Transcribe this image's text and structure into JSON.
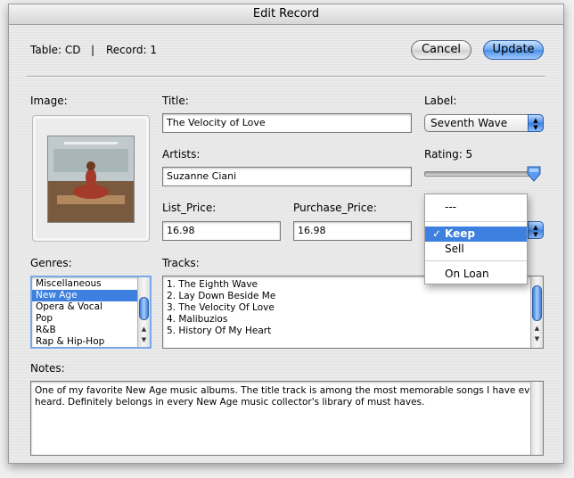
{
  "window": {
    "title": "Edit Record"
  },
  "header": {
    "table_text": "Table: CD",
    "separator": "|",
    "record_text": "Record: 1"
  },
  "buttons": {
    "cancel": "Cancel",
    "update": "Update"
  },
  "image": {
    "label": "Image:",
    "album_art_description": "album cover"
  },
  "title": {
    "label": "Title:",
    "value": "The Velocity of Love"
  },
  "artists": {
    "label": "Artists:",
    "value": "Suzanne Ciani"
  },
  "list_price": {
    "label": "List_Price:",
    "value": "16.98"
  },
  "purchase_price": {
    "label": "Purchase_Price:",
    "value": "16.98"
  },
  "label_field": {
    "label": "Label:",
    "value": "Seventh Wave"
  },
  "rating": {
    "label": "Rating: 5",
    "value": 5,
    "max": 5
  },
  "status_menu": {
    "items": [
      {
        "label": "---",
        "checked": false
      },
      {
        "label": "Keep",
        "checked": true,
        "check_mark": "✓"
      },
      {
        "label": "Sell",
        "checked": false
      },
      {
        "label": "On Loan",
        "checked": false
      }
    ]
  },
  "genres": {
    "label": "Genres:",
    "items": [
      "Miscellaneous",
      "New Age",
      "Opera & Vocal",
      "Pop",
      "R&B",
      "Rap & Hip-Hop"
    ],
    "selected": "New Age"
  },
  "tracks": {
    "label": "Tracks:",
    "items": [
      "1. The Eighth Wave",
      "2. Lay Down Beside Me",
      "3. The Velocity Of Love",
      "4. Malibuzios",
      "5. History Of My Heart"
    ]
  },
  "notes": {
    "label": "Notes:",
    "value_line1": "One of my favorite New Age music albums. The title track is among the most memorable songs I have ever",
    "value_line2": "heard. Definitely belongs in every New Age music collector's library of must haves."
  },
  "colors": {
    "selection": "#3d80df",
    "default_button": "#4a8ee6"
  },
  "icons": {
    "popup_arrows": "up-down-arrows-icon",
    "check": "checkmark-icon"
  }
}
